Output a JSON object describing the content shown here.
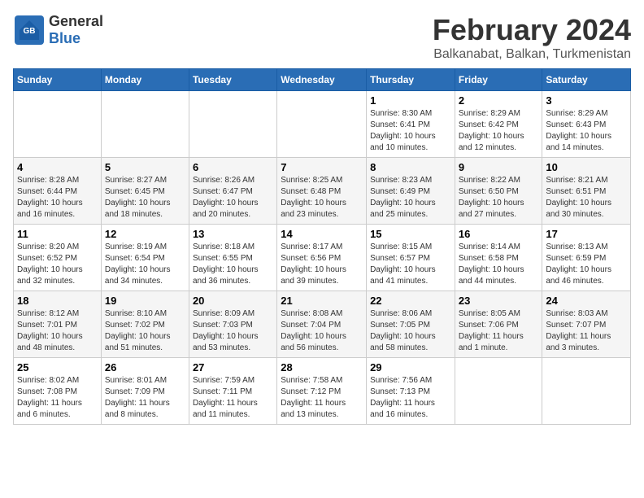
{
  "logo": {
    "general": "General",
    "blue": "Blue"
  },
  "title": "February 2024",
  "subtitle": "Balkanabat, Balkan, Turkmenistan",
  "days_of_week": [
    "Sunday",
    "Monday",
    "Tuesday",
    "Wednesday",
    "Thursday",
    "Friday",
    "Saturday"
  ],
  "weeks": [
    [
      {
        "day": "",
        "info": ""
      },
      {
        "day": "",
        "info": ""
      },
      {
        "day": "",
        "info": ""
      },
      {
        "day": "",
        "info": ""
      },
      {
        "day": "1",
        "info": "Sunrise: 8:30 AM\nSunset: 6:41 PM\nDaylight: 10 hours\nand 10 minutes."
      },
      {
        "day": "2",
        "info": "Sunrise: 8:29 AM\nSunset: 6:42 PM\nDaylight: 10 hours\nand 12 minutes."
      },
      {
        "day": "3",
        "info": "Sunrise: 8:29 AM\nSunset: 6:43 PM\nDaylight: 10 hours\nand 14 minutes."
      }
    ],
    [
      {
        "day": "4",
        "info": "Sunrise: 8:28 AM\nSunset: 6:44 PM\nDaylight: 10 hours\nand 16 minutes."
      },
      {
        "day": "5",
        "info": "Sunrise: 8:27 AM\nSunset: 6:45 PM\nDaylight: 10 hours\nand 18 minutes."
      },
      {
        "day": "6",
        "info": "Sunrise: 8:26 AM\nSunset: 6:47 PM\nDaylight: 10 hours\nand 20 minutes."
      },
      {
        "day": "7",
        "info": "Sunrise: 8:25 AM\nSunset: 6:48 PM\nDaylight: 10 hours\nand 23 minutes."
      },
      {
        "day": "8",
        "info": "Sunrise: 8:23 AM\nSunset: 6:49 PM\nDaylight: 10 hours\nand 25 minutes."
      },
      {
        "day": "9",
        "info": "Sunrise: 8:22 AM\nSunset: 6:50 PM\nDaylight: 10 hours\nand 27 minutes."
      },
      {
        "day": "10",
        "info": "Sunrise: 8:21 AM\nSunset: 6:51 PM\nDaylight: 10 hours\nand 30 minutes."
      }
    ],
    [
      {
        "day": "11",
        "info": "Sunrise: 8:20 AM\nSunset: 6:52 PM\nDaylight: 10 hours\nand 32 minutes."
      },
      {
        "day": "12",
        "info": "Sunrise: 8:19 AM\nSunset: 6:54 PM\nDaylight: 10 hours\nand 34 minutes."
      },
      {
        "day": "13",
        "info": "Sunrise: 8:18 AM\nSunset: 6:55 PM\nDaylight: 10 hours\nand 36 minutes."
      },
      {
        "day": "14",
        "info": "Sunrise: 8:17 AM\nSunset: 6:56 PM\nDaylight: 10 hours\nand 39 minutes."
      },
      {
        "day": "15",
        "info": "Sunrise: 8:15 AM\nSunset: 6:57 PM\nDaylight: 10 hours\nand 41 minutes."
      },
      {
        "day": "16",
        "info": "Sunrise: 8:14 AM\nSunset: 6:58 PM\nDaylight: 10 hours\nand 44 minutes."
      },
      {
        "day": "17",
        "info": "Sunrise: 8:13 AM\nSunset: 6:59 PM\nDaylight: 10 hours\nand 46 minutes."
      }
    ],
    [
      {
        "day": "18",
        "info": "Sunrise: 8:12 AM\nSunset: 7:01 PM\nDaylight: 10 hours\nand 48 minutes."
      },
      {
        "day": "19",
        "info": "Sunrise: 8:10 AM\nSunset: 7:02 PM\nDaylight: 10 hours\nand 51 minutes."
      },
      {
        "day": "20",
        "info": "Sunrise: 8:09 AM\nSunset: 7:03 PM\nDaylight: 10 hours\nand 53 minutes."
      },
      {
        "day": "21",
        "info": "Sunrise: 8:08 AM\nSunset: 7:04 PM\nDaylight: 10 hours\nand 56 minutes."
      },
      {
        "day": "22",
        "info": "Sunrise: 8:06 AM\nSunset: 7:05 PM\nDaylight: 10 hours\nand 58 minutes."
      },
      {
        "day": "23",
        "info": "Sunrise: 8:05 AM\nSunset: 7:06 PM\nDaylight: 11 hours\nand 1 minute."
      },
      {
        "day": "24",
        "info": "Sunrise: 8:03 AM\nSunset: 7:07 PM\nDaylight: 11 hours\nand 3 minutes."
      }
    ],
    [
      {
        "day": "25",
        "info": "Sunrise: 8:02 AM\nSunset: 7:08 PM\nDaylight: 11 hours\nand 6 minutes."
      },
      {
        "day": "26",
        "info": "Sunrise: 8:01 AM\nSunset: 7:09 PM\nDaylight: 11 hours\nand 8 minutes."
      },
      {
        "day": "27",
        "info": "Sunrise: 7:59 AM\nSunset: 7:11 PM\nDaylight: 11 hours\nand 11 minutes."
      },
      {
        "day": "28",
        "info": "Sunrise: 7:58 AM\nSunset: 7:12 PM\nDaylight: 11 hours\nand 13 minutes."
      },
      {
        "day": "29",
        "info": "Sunrise: 7:56 AM\nSunset: 7:13 PM\nDaylight: 11 hours\nand 16 minutes."
      },
      {
        "day": "",
        "info": ""
      },
      {
        "day": "",
        "info": ""
      }
    ]
  ]
}
